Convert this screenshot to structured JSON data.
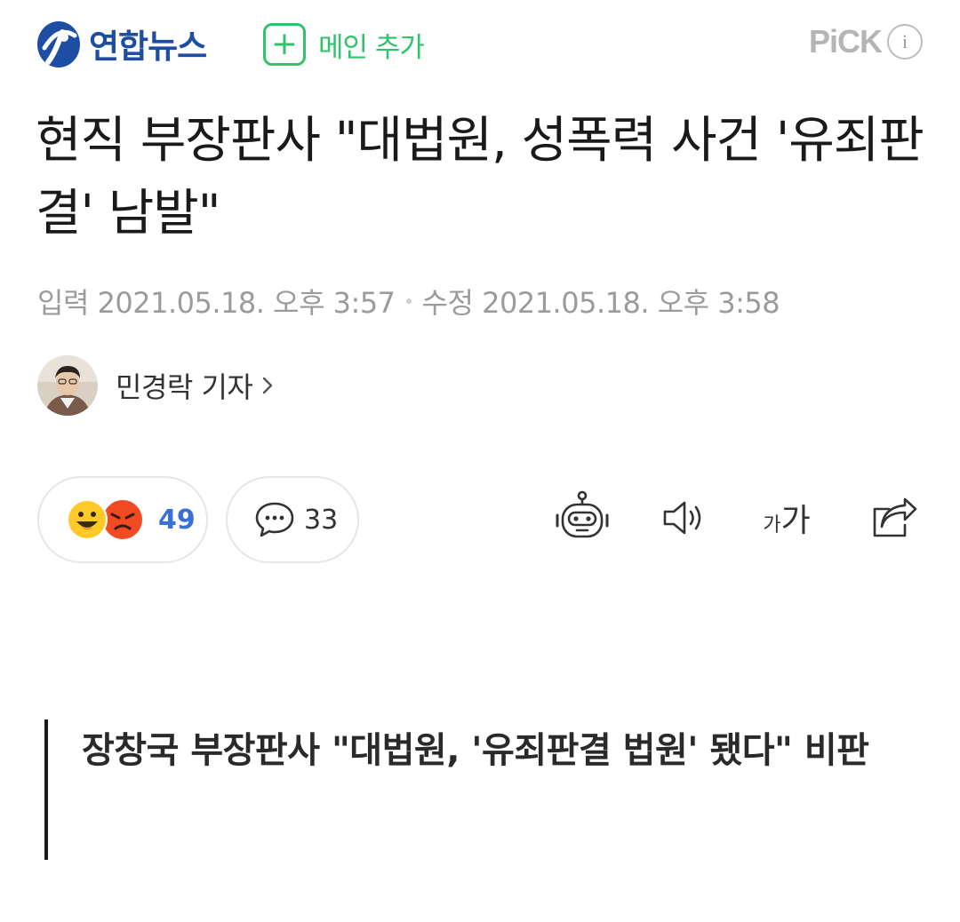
{
  "header": {
    "brand_name": "연합뉴스",
    "add_main_icon": "plus-icon",
    "add_main_label": "메인 추가",
    "pick_label": "PiCK",
    "info_icon_glyph": "i",
    "colors": {
      "brand": "#1d4ea3",
      "add_main": "#2ec46b",
      "pick": "#b5b5b5"
    }
  },
  "article": {
    "title": "현직 부장판사 \"대법원, 성폭력 사건 '유죄판결' 남발\"",
    "input_label": "입력",
    "input_time": "2021.05.18. 오후 3:57",
    "modified_label": "수정",
    "modified_time": "2021.05.18. 오후 3:58",
    "reporter": "민경락 기자",
    "subheadline": "장창국 부장판사 \"대법원, '유죄판결 법원' 됐다\" 비판"
  },
  "actions": {
    "reaction_count": "49",
    "reaction_icons": [
      "smile-emoji-icon",
      "angry-emoji-icon"
    ],
    "comment_count": "33",
    "comment_icon": "speech-bubble-icon",
    "tools": [
      "robot-summary-icon",
      "speaker-icon",
      "font-size-icon",
      "share-icon"
    ],
    "font_small_glyph": "가",
    "font_big_glyph": "가",
    "colors": {
      "reaction_count": "#3a6fd8"
    }
  }
}
